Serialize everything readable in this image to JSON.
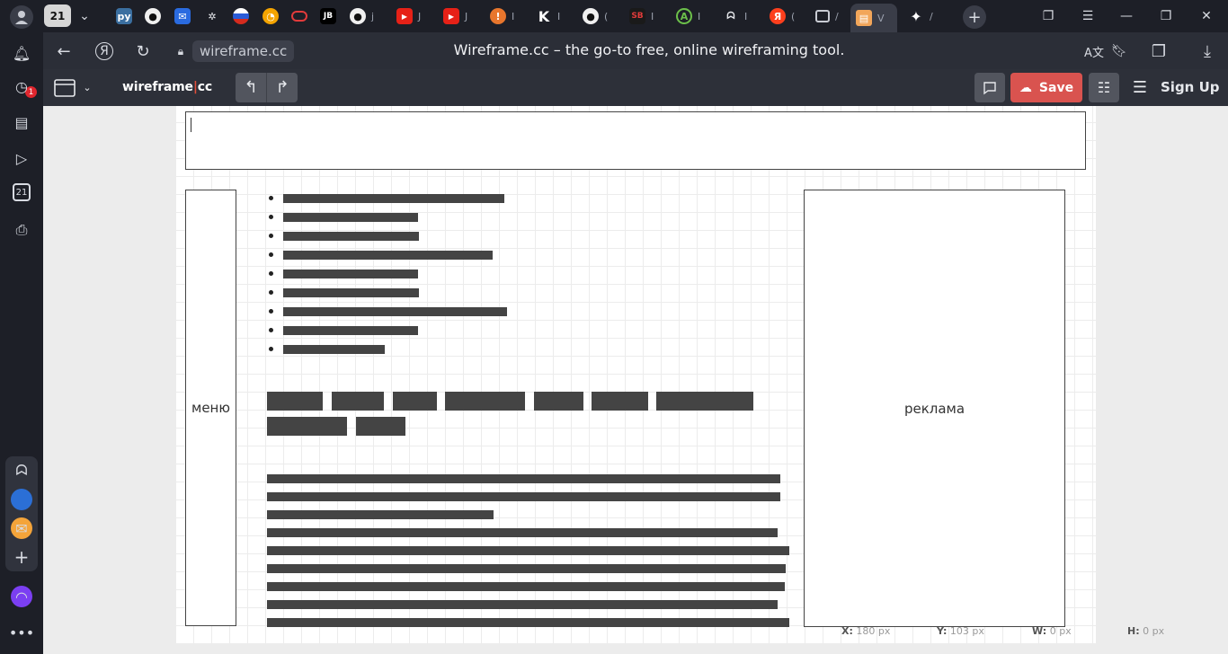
{
  "browser": {
    "tab_count": "21",
    "active_tab_initial": "V",
    "url": "wireframe.cc",
    "page_title": "Wireframe.cc – the go-to free, online wireframing tool.",
    "notification_count": "1",
    "calendar_day": "21",
    "tabs": [
      {
        "icon": "python-icon",
        "title": ""
      },
      {
        "icon": "github-icon",
        "title": ""
      },
      {
        "icon": "mail-icon",
        "title": ""
      },
      {
        "icon": "chatgpt-icon",
        "title": ""
      },
      {
        "icon": "flag-icon",
        "title": ""
      },
      {
        "icon": "ring-icon",
        "title": ""
      },
      {
        "icon": "pill-icon",
        "title": ""
      },
      {
        "icon": "jetbrains-icon",
        "title": ""
      },
      {
        "icon": "github-icon",
        "title": "j"
      },
      {
        "icon": "youtube-icon",
        "title": "J"
      },
      {
        "icon": "youtube-icon",
        "title": "J"
      },
      {
        "icon": "bell-orange-icon",
        "title": "I"
      },
      {
        "icon": "k-icon",
        "title": "I"
      },
      {
        "icon": "github-icon",
        "title": "("
      },
      {
        "icon": "sb-icon",
        "title": "I"
      },
      {
        "icon": "a-icon",
        "title": "I"
      },
      {
        "icon": "chat-icon",
        "title": "I"
      },
      {
        "icon": "yandex-icon",
        "title": "("
      },
      {
        "icon": "window-icon",
        "title": "/"
      },
      {
        "icon": "wireframe-icon",
        "title": "V"
      },
      {
        "icon": "sparkle-icon",
        "title": "/"
      }
    ]
  },
  "toolbar": {
    "logo_left": "wireframe",
    "logo_sep": "|",
    "logo_right": "cc",
    "undo_icon": "undo-icon",
    "redo_icon": "redo-icon",
    "save_label": "Save",
    "signup_label": "Sign Up"
  },
  "wireframe": {
    "menu_label": "меню",
    "ad_label": "реклама"
  },
  "status": {
    "x_label": "X:",
    "x_value": "180 px",
    "y_label": "Y:",
    "y_value": "103 px",
    "w_label": "W:",
    "w_value": "0 px",
    "h_label": "H:",
    "h_value": "0 px"
  }
}
